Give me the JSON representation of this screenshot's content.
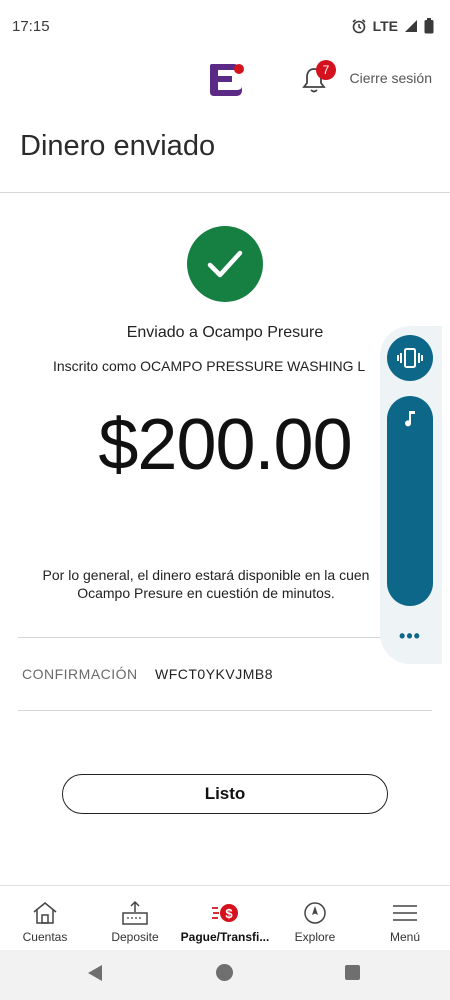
{
  "status_bar": {
    "time": "17:15",
    "network": "LTE"
  },
  "header": {
    "notification_count": "7",
    "logout_label": "Cierre sesión"
  },
  "page": {
    "title": "Dinero enviado"
  },
  "confirmation": {
    "sent_to": "Enviado a Ocampo Presure",
    "registered_as": "Inscrito como OCAMPO PRESSURE WASHING L",
    "amount": "$200.00",
    "availability_line1": "Por lo general, el dinero estará disponible en la cuen",
    "availability_line2": "Ocampo Presure en cuestión de minutos.",
    "confirmation_label": "CONFIRMACIÓN",
    "confirmation_number": "WFCT0YKVJMB8",
    "done_label": "Listo"
  },
  "nav": {
    "items": [
      {
        "label": "Cuentas",
        "icon": "home-icon"
      },
      {
        "label": "Deposite",
        "icon": "deposit-icon"
      },
      {
        "label": "Pague/Transfi...",
        "icon": "pay-transfer-icon",
        "active": true
      },
      {
        "label": "Explore",
        "icon": "compass-icon"
      },
      {
        "label": "Menú",
        "icon": "hamburger-menu-icon"
      }
    ]
  },
  "colors": {
    "success_green": "#168042",
    "badge_red": "#d4121e",
    "floating_teal": "#0d6789"
  }
}
